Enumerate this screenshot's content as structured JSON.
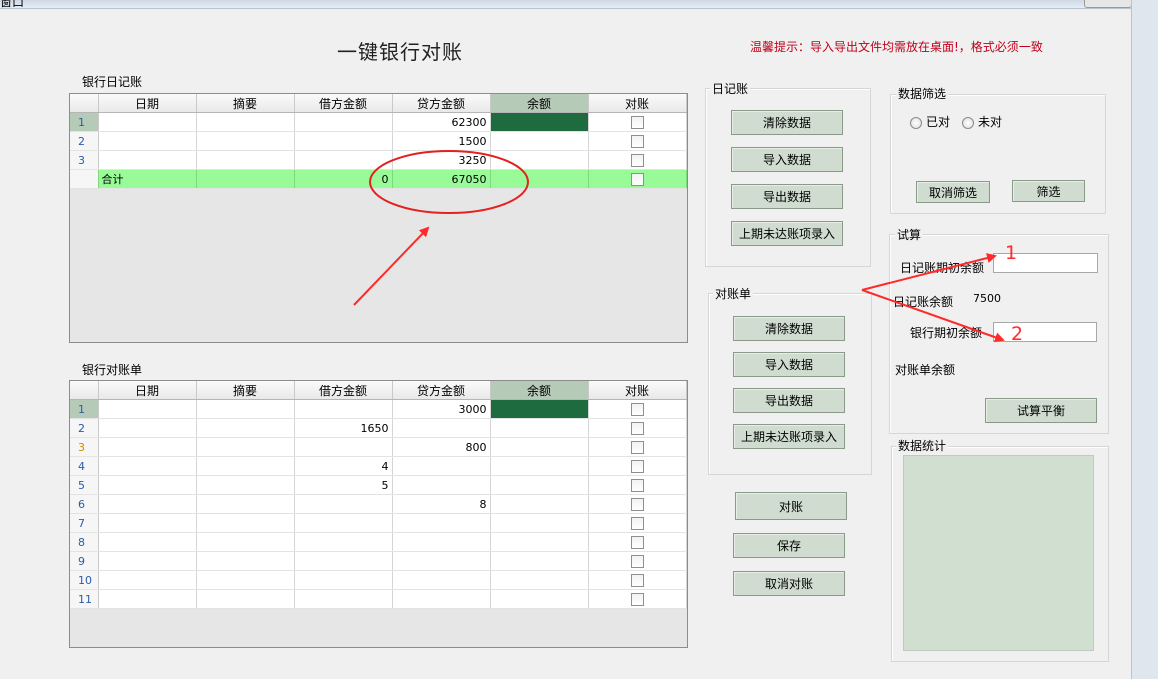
{
  "window": {
    "title": "窗口"
  },
  "heading": "一键银行对账",
  "tip": "温馨提示：导入导出文件均需放在桌面!，格式必须一致",
  "journal_grid": {
    "label": "银行日记账",
    "columns": [
      "日期",
      "摘要",
      "借方金额",
      "贷方金额",
      "余额",
      "对账"
    ],
    "rows": [
      {
        "n": "1",
        "date": "",
        "summary": "",
        "debit": "",
        "credit": "62300"
      },
      {
        "n": "2",
        "date": "",
        "summary": "",
        "debit": "",
        "credit": "1500"
      },
      {
        "n": "3",
        "date": "",
        "summary": "",
        "debit": "",
        "credit": "3250"
      }
    ],
    "total": {
      "label": "合计",
      "debit": "0",
      "credit": "67050"
    }
  },
  "statement_grid": {
    "label": "银行对账单",
    "columns": [
      "日期",
      "摘要",
      "借方金额",
      "贷方金额",
      "余额",
      "对账"
    ],
    "rows": [
      {
        "n": "1",
        "debit": "",
        "credit": "3000"
      },
      {
        "n": "2",
        "debit": "1650",
        "credit": ""
      },
      {
        "n": "3",
        "debit": "",
        "credit": "800"
      },
      {
        "n": "4",
        "debit": "4",
        "credit": ""
      },
      {
        "n": "5",
        "debit": "5",
        "credit": ""
      },
      {
        "n": "6",
        "debit": "",
        "credit": "8"
      },
      {
        "n": "7",
        "debit": "",
        "credit": ""
      },
      {
        "n": "8",
        "debit": "",
        "credit": ""
      },
      {
        "n": "9",
        "debit": "",
        "credit": ""
      },
      {
        "n": "10",
        "debit": "",
        "credit": ""
      },
      {
        "n": "11",
        "debit": "",
        "credit": ""
      }
    ]
  },
  "journal_group": {
    "label": "日记账",
    "clear": "清除数据",
    "import": "导入数据",
    "export": "导出数据",
    "carry": "上期未达账项录入"
  },
  "statement_group": {
    "label": "对账单",
    "clear": "清除数据",
    "import": "导入数据",
    "export": "导出数据",
    "carry": "上期未达账项录入"
  },
  "actions": {
    "reconcile": "对账",
    "save": "保存",
    "cancel": "取消对账"
  },
  "filter": {
    "label": "数据筛选",
    "opt_done": "已对",
    "opt_undone": "未对",
    "cancel": "取消筛选",
    "apply": "筛选"
  },
  "trial": {
    "label": "试算",
    "journal_opening": "日记账期初余额",
    "journal_balance": "日记账余额",
    "journal_balance_value": "7500",
    "bank_opening": "银行期初余额",
    "statement_balance": "对账单余额",
    "button": "试算平衡"
  },
  "stats": {
    "label": "数据统计"
  },
  "annotations": {
    "n1": "1",
    "n2": "2"
  },
  "colors": {
    "accent": "#ff2a2a",
    "total_row": "#98fb98",
    "balance_cell": "#1f6b40",
    "button": "#cfdccf"
  }
}
